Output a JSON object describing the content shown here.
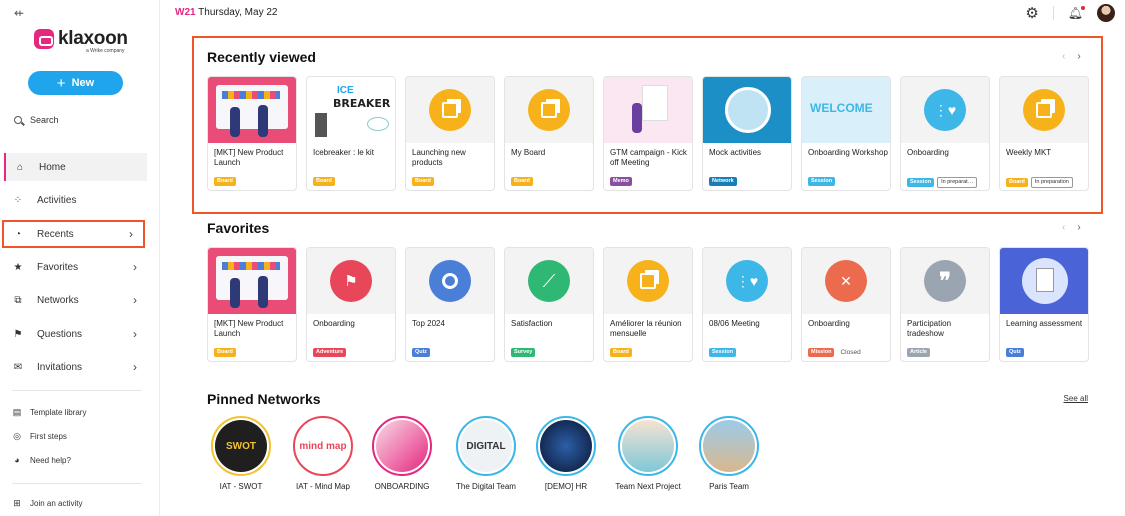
{
  "sidebar": {
    "logo_text": "klaxoon",
    "logo_sub": "a Wrike company",
    "new_label": "New",
    "search_label": "Search",
    "items": [
      {
        "label": "Home",
        "icon": "home-icon",
        "glyph": "⌂"
      },
      {
        "label": "Activities",
        "icon": "grid-icon",
        "glyph": "⁘"
      },
      {
        "label": "Recents",
        "icon": "clock-icon",
        "glyph": "◔"
      },
      {
        "label": "Favorites",
        "icon": "star-icon",
        "glyph": "★"
      },
      {
        "label": "Networks",
        "icon": "network-icon",
        "glyph": "⧉"
      },
      {
        "label": "Questions",
        "icon": "question-icon",
        "glyph": "⚑"
      },
      {
        "label": "Invitations",
        "icon": "mail-icon",
        "glyph": "✉"
      }
    ],
    "footer": [
      {
        "label": "Template library",
        "icon": "template-icon",
        "glyph": "▤"
      },
      {
        "label": "First steps",
        "icon": "compass-icon",
        "glyph": "◎"
      },
      {
        "label": "Need help?",
        "icon": "help-icon",
        "glyph": "◕"
      },
      {
        "label": "Join an activity",
        "icon": "qr-icon",
        "glyph": "⊞"
      }
    ]
  },
  "header": {
    "week": "W21",
    "date": "Thursday, May 22"
  },
  "sections": {
    "recent_title": "Recently viewed",
    "favorites_title": "Favorites",
    "networks_title": "Pinned Networks",
    "see_all": "See all",
    "prev": "‹",
    "next": "›"
  },
  "colors": {
    "brand": "#e5277f",
    "accent": "#1fa5ec",
    "highlight": "#f0552a",
    "board": "#f7b21b",
    "memo": "#8a4f9e",
    "network": "#157eb8",
    "session": "#3cb7e8",
    "adventure": "#e8475a",
    "quiz": "#4a7fd8",
    "survey": "#2eb873",
    "mission": "#ec6b4e",
    "article": "#9aa5b1"
  },
  "recent": [
    {
      "title": "[MKT] New Product Launch",
      "tags": [
        {
          "text": "Board",
          "type": "board"
        }
      ],
      "thumb": "people-illustration"
    },
    {
      "title": "Icebreaker : le kit",
      "tags": [
        {
          "text": "Board",
          "type": "board"
        }
      ],
      "thumb": "icebreaker-illustration"
    },
    {
      "title": "Launching new products",
      "tags": [
        {
          "text": "Board",
          "type": "board"
        }
      ],
      "thumb": "board-circle"
    },
    {
      "title": "My Board",
      "tags": [
        {
          "text": "Board",
          "type": "board"
        }
      ],
      "thumb": "board-circle"
    },
    {
      "title": "GTM campaign - Kick off Meeting",
      "tags": [
        {
          "text": "Memo",
          "type": "memo"
        }
      ],
      "thumb": "memo-illustration"
    },
    {
      "title": "Mock activities",
      "tags": [
        {
          "text": "Network",
          "type": "network"
        }
      ],
      "thumb": "network-image"
    },
    {
      "title": "Onboarding Workshop",
      "tags": [
        {
          "text": "Session",
          "type": "session"
        }
      ],
      "thumb": "welcome-image"
    },
    {
      "title": "Onboarding",
      "tags": [
        {
          "text": "Session",
          "type": "session"
        },
        {
          "text": "In preparat…",
          "type": "plain"
        }
      ],
      "thumb": "session-circle"
    },
    {
      "title": "Weekly MKT",
      "tags": [
        {
          "text": "Board",
          "type": "board"
        },
        {
          "text": "In preparation",
          "type": "plain"
        }
      ],
      "thumb": "board-circle"
    }
  ],
  "favorites": [
    {
      "title": "[MKT] New Product Launch",
      "tags": [
        {
          "text": "Board",
          "type": "board"
        }
      ],
      "thumb": "people-illustration"
    },
    {
      "title": "Onboarding",
      "tags": [
        {
          "text": "Adventure",
          "type": "adventure"
        }
      ],
      "thumb": "adventure-circle"
    },
    {
      "title": "Top 2024",
      "tags": [
        {
          "text": "Quiz",
          "type": "quiz"
        }
      ],
      "thumb": "quiz-circle"
    },
    {
      "title": "Satisfaction",
      "tags": [
        {
          "text": "Survey",
          "type": "survey"
        }
      ],
      "thumb": "survey-circle"
    },
    {
      "title": "Améliorer la réunion mensuelle",
      "tags": [
        {
          "text": "Board",
          "type": "board"
        }
      ],
      "thumb": "board-circle"
    },
    {
      "title": "08/06 Meeting",
      "tags": [
        {
          "text": "Session",
          "type": "session"
        }
      ],
      "thumb": "session-circle"
    },
    {
      "title": "Onboarding",
      "tags": [
        {
          "text": "Mission",
          "type": "mission"
        },
        {
          "text": "Closed",
          "type": "closed"
        }
      ],
      "thumb": "mission-circle"
    },
    {
      "title": "Participation tradeshow",
      "tags": [
        {
          "text": "Article",
          "type": "article"
        }
      ],
      "thumb": "article-circle"
    },
    {
      "title": "Learning assessment",
      "tags": [
        {
          "text": "Quiz",
          "type": "quiz"
        }
      ],
      "thumb": "learning-illustration"
    }
  ],
  "networks": [
    {
      "label": "IAT - SWOT",
      "art": "SWOT",
      "ring": "#f2c230"
    },
    {
      "label": "IAT - Mind Map",
      "art": "mind map",
      "ring": "#e8475a"
    },
    {
      "label": "ONBOARDING",
      "art": "",
      "ring": "#e5277f"
    },
    {
      "label": "The Digital Team",
      "art": "DIGITAL",
      "ring": "#3cb7e8"
    },
    {
      "label": "[DEMO] HR",
      "art": "",
      "ring": "#3cb7e8"
    },
    {
      "label": "Team Next Project",
      "art": "",
      "ring": "#3cb7e8"
    },
    {
      "label": "Paris Team",
      "art": "",
      "ring": "#3cb7e8"
    }
  ]
}
